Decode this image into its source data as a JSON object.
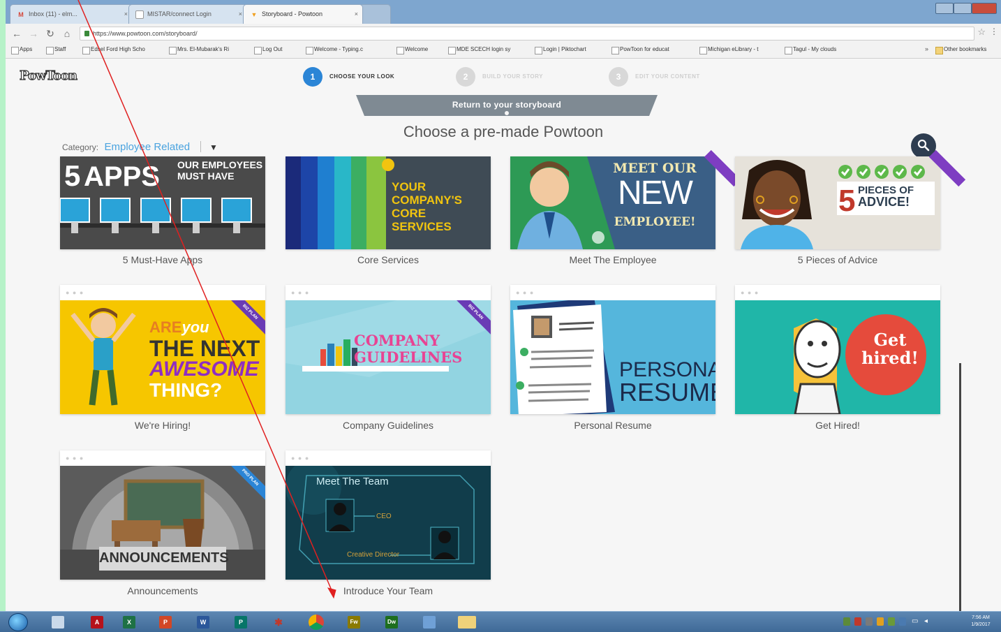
{
  "browser": {
    "tabs": [
      {
        "title": "Inbox (11) - elm...",
        "icon": "gmail-icon",
        "icon_char": "M",
        "icon_color": "#d44638"
      },
      {
        "title": "MISTAR/connect Login",
        "icon": "page-icon",
        "icon_char": "",
        "icon_color": "#ffffff"
      },
      {
        "title": "Storyboard - Powtoon",
        "icon": "powtoon-icon",
        "icon_char": "▼",
        "icon_color": "#f0a020"
      }
    ],
    "url": "https://www.powtoon.com/storyboard/",
    "bookmarks": [
      {
        "label": "Apps",
        "icon": "apps-icon"
      },
      {
        "label": "Staff",
        "icon": "page-icon"
      },
      {
        "label": "Edsel Ford High Scho",
        "icon": "page-icon"
      },
      {
        "label": "Mrs. El-Mubarak's Ri",
        "icon": "page-icon"
      },
      {
        "label": "Log Out",
        "icon": "page-icon"
      },
      {
        "label": "Welcome - Typing.c",
        "icon": "page-icon"
      },
      {
        "label": "Welcome",
        "icon": "page-icon"
      },
      {
        "label": "MDE SCECH login sy",
        "icon": "page-icon"
      },
      {
        "label": "Login | Piktochart",
        "icon": "page-icon"
      },
      {
        "label": "PowToon for educat",
        "icon": "powtoon-icon"
      },
      {
        "label": "Michigan eLibrary - t",
        "icon": "page-icon"
      },
      {
        "label": "Tagul - My clouds",
        "icon": "page-icon"
      }
    ],
    "bookmarks_more": "»",
    "other_bookmarks": "Other bookmarks"
  },
  "app": {
    "logo": "PowToon",
    "steps": [
      {
        "num": "1",
        "label": "CHOOSE YOUR LOOK",
        "active": true
      },
      {
        "num": "2",
        "label": "BUILD YOUR STORY",
        "active": false
      },
      {
        "num": "3",
        "label": "EDIT YOUR CONTENT",
        "active": false
      }
    ],
    "return_label": "Return to your storyboard",
    "headline": "Choose a pre-made Powtoon",
    "category_label": "Category:",
    "category_value": "Employee Related",
    "templates": [
      {
        "title": "5 Must-Have Apps",
        "thumb_text": [
          "APPS",
          "OUR EMPLOYEES MUST HAVE"
        ],
        "number": "5"
      },
      {
        "title": "Core Services",
        "thumb_text": [
          "YOUR",
          "COMPANY'S",
          "CORE",
          "SERVICES"
        ]
      },
      {
        "title": "Meet The Employee",
        "thumb_text": [
          "MEET OUR",
          "NEW",
          "EMPLOYEE!"
        ]
      },
      {
        "title": "5 Pieces of Advice",
        "thumb_text": [
          "PIECES OF",
          "ADVICE!"
        ],
        "number": "5"
      },
      {
        "title": "We're Hiring!",
        "thumb_text": [
          "ARE",
          "you",
          "THE NEXT",
          "AWESOME",
          "THING?"
        ],
        "ribbon": "BIZ PLAN"
      },
      {
        "title": "Company Guidelines",
        "thumb_text": [
          "COMPANY",
          "GUIDELINES"
        ],
        "ribbon": "BIZ PLAN"
      },
      {
        "title": "Personal Resume",
        "thumb_text": [
          "PERSONAL",
          "RESUME"
        ]
      },
      {
        "title": "Get Hired!",
        "thumb_text": [
          "Get",
          "hired!"
        ]
      },
      {
        "title": "Announcements",
        "thumb_text": [
          "ANNOUNCEMENTS"
        ],
        "ribbon": "PRO PLAN"
      },
      {
        "title": "Introduce Your Team",
        "thumb_text": [
          "Meet The Team",
          "CEO",
          "Creative Director"
        ]
      }
    ]
  },
  "taskbar": {
    "apps": [
      {
        "name": "explorer",
        "char": "",
        "color": "#c9d9ea"
      },
      {
        "name": "acrobat",
        "char": "A",
        "color": "#b5121b"
      },
      {
        "name": "excel",
        "char": "X",
        "color": "#1e7145"
      },
      {
        "name": "powerpoint",
        "char": "P",
        "color": "#d24726"
      },
      {
        "name": "word",
        "char": "W",
        "color": "#2b579a"
      },
      {
        "name": "publisher",
        "char": "P",
        "color": "#077568"
      },
      {
        "name": "spider-solitaire",
        "char": "✱",
        "color": "#c0392b"
      },
      {
        "name": "chrome",
        "char": "",
        "color": "#f4b400"
      },
      {
        "name": "fireworks",
        "char": "Fw",
        "color": "#8a7a00"
      },
      {
        "name": "dreamweaver",
        "char": "Dw",
        "color": "#1e6e1e"
      },
      {
        "name": "network",
        "char": "",
        "color": "#6fa0d6"
      },
      {
        "name": "folder",
        "char": "",
        "color": "#f0d27a"
      }
    ],
    "time": "7:56 AM",
    "date": "1/9/2017"
  }
}
